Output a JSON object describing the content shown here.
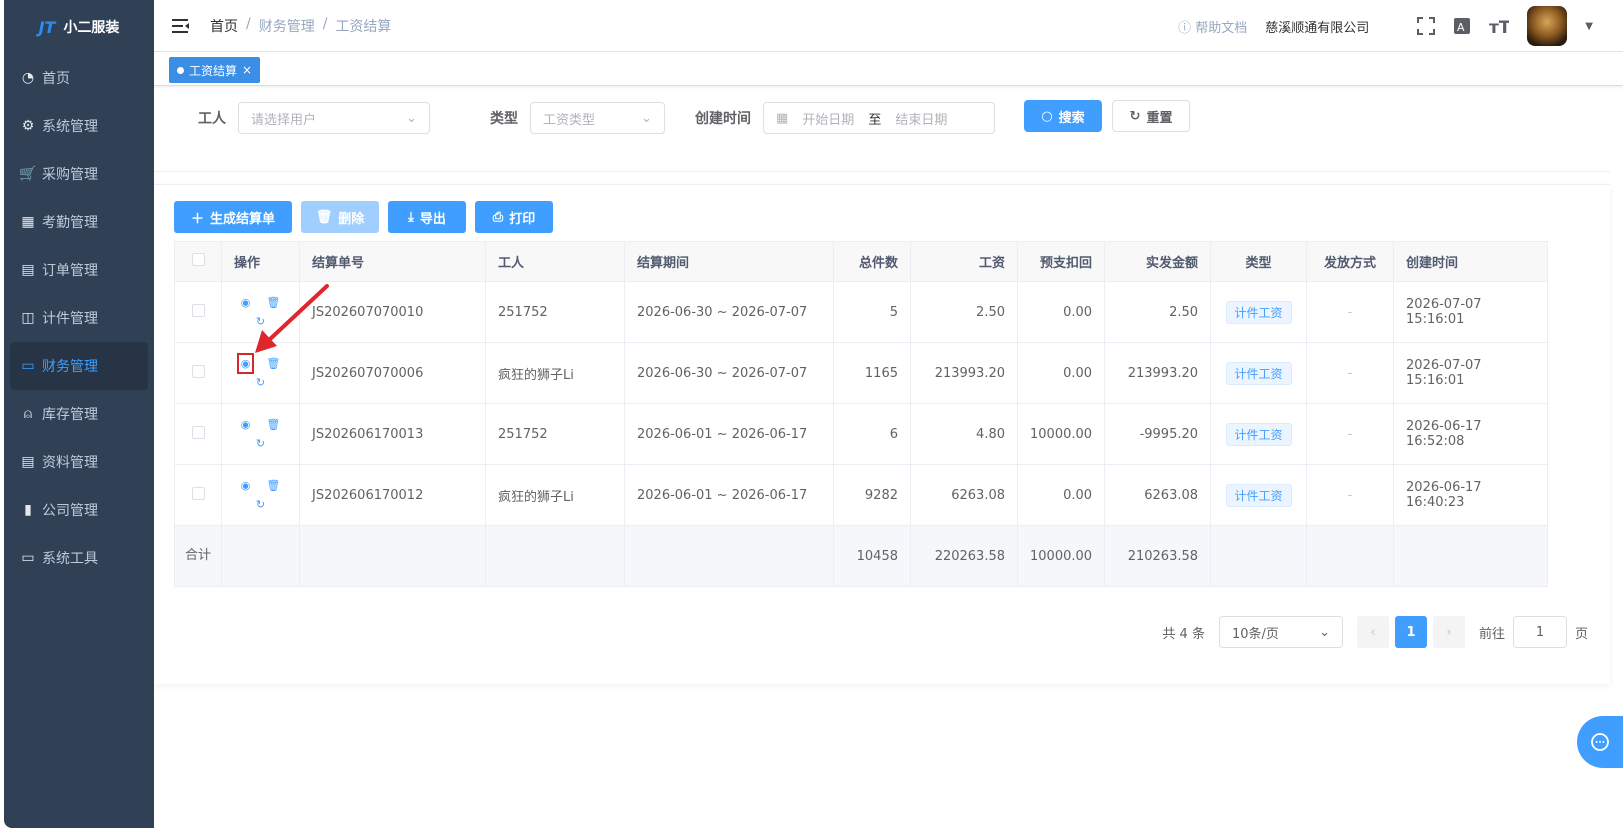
{
  "app": {
    "name": "小二服装",
    "logo_mark": "JT"
  },
  "sidebar": {
    "items": [
      {
        "label": "首页",
        "icon": "dashboard-icon"
      },
      {
        "label": "系统管理",
        "icon": "gear-icon"
      },
      {
        "label": "采购管理",
        "icon": "cart-icon"
      },
      {
        "label": "考勤管理",
        "icon": "grid-icon"
      },
      {
        "label": "订单管理",
        "icon": "order-icon"
      },
      {
        "label": "计件管理",
        "icon": "book-icon"
      },
      {
        "label": "财务管理",
        "icon": "chart-monitor-icon",
        "active": true
      },
      {
        "label": "库存管理",
        "icon": "user-icon"
      },
      {
        "label": "资料管理",
        "icon": "document-icon"
      },
      {
        "label": "公司管理",
        "icon": "bar-chart-icon"
      },
      {
        "label": "系统工具",
        "icon": "toolbox-icon"
      }
    ]
  },
  "header": {
    "breadcrumb": [
      "首页",
      "财务管理",
      "工资结算"
    ],
    "help": "帮助文档",
    "company": "慈溪顺通有限公司"
  },
  "tags": {
    "active": "工资结算"
  },
  "search": {
    "worker_label": "工人",
    "worker_placeholder": "请选择用户",
    "type_label": "类型",
    "type_placeholder": "工资类型",
    "created_label": "创建时间",
    "start_placeholder": "开始日期",
    "to": "至",
    "end_placeholder": "结束日期",
    "search_btn": "搜索",
    "reset_btn": "重置"
  },
  "toolbar": {
    "generate": "生成结算单",
    "delete": "删除",
    "export": "导出",
    "print": "打印"
  },
  "table": {
    "headers": [
      "操作",
      "结算单号",
      "工人",
      "结算期间",
      "总件数",
      "工资",
      "预支扣回",
      "实发金额",
      "类型",
      "发放方式",
      "创建时间"
    ],
    "rows": [
      {
        "no": "JS202607070010",
        "worker": "251752",
        "period": "2026-06-30 ~ 2026-07-07",
        "count": "5",
        "wage": "2.50",
        "advance": "0.00",
        "actual": "2.50",
        "type": "计件工资",
        "method": "-",
        "created": "2026-07-07 15:16:01"
      },
      {
        "no": "JS202607070006",
        "worker": "疯狂的狮子Li",
        "period": "2026-06-30 ~ 2026-07-07",
        "count": "1165",
        "wage": "213993.20",
        "advance": "0.00",
        "actual": "213993.20",
        "type": "计件工资",
        "method": "-",
        "created": "2026-07-07 15:16:01"
      },
      {
        "no": "JS202606170013",
        "worker": "251752",
        "period": "2026-06-01 ~ 2026-06-17",
        "count": "6",
        "wage": "4.80",
        "advance": "10000.00",
        "actual": "-9995.20",
        "type": "计件工资",
        "method": "-",
        "created": "2026-06-17 16:52:08"
      },
      {
        "no": "JS202606170012",
        "worker": "疯狂的狮子Li",
        "period": "2026-06-01 ~ 2026-06-17",
        "count": "9282",
        "wage": "6263.08",
        "advance": "0.00",
        "actual": "6263.08",
        "type": "计件工资",
        "method": "-",
        "created": "2026-06-17 16:40:23"
      }
    ],
    "summary": {
      "label": "合计",
      "count": "10458",
      "wage": "220263.58",
      "advance": "10000.00",
      "actual": "210263.58"
    }
  },
  "pagination": {
    "total": "共 4 条",
    "page_size": "10条/页",
    "current": "1",
    "goto_label": "前往",
    "goto_value": "1",
    "page_suffix": "页"
  }
}
